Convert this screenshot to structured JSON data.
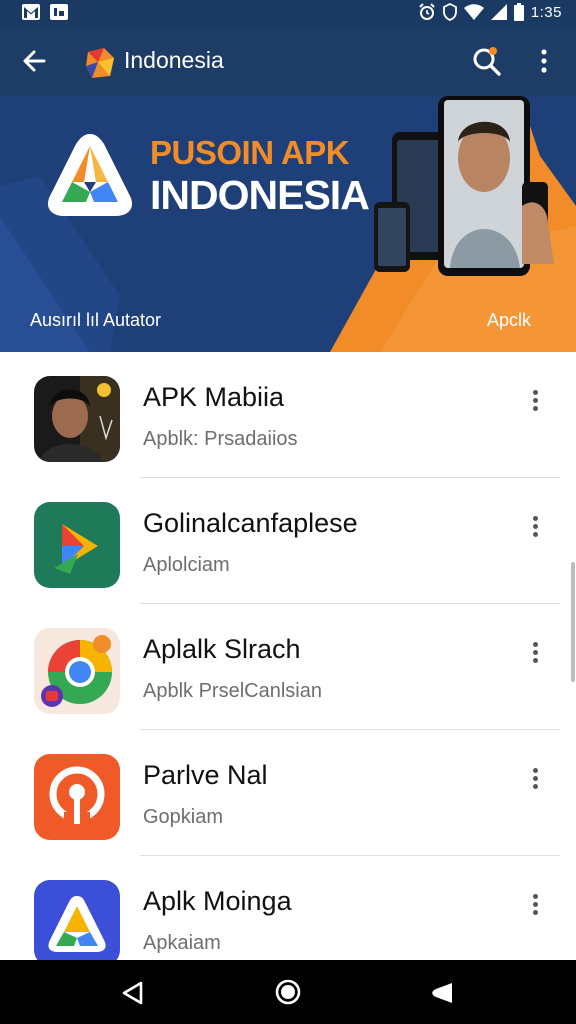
{
  "status_bar": {
    "time": "1:35",
    "icons": [
      "gmail-icon",
      "notification-icon",
      "alarm-icon",
      "vpn-icon",
      "wifi-icon",
      "signal-icon",
      "battery-icon"
    ]
  },
  "app_bar": {
    "title": "Indonesia",
    "icons": [
      "back-arrow-icon",
      "brand-logo-icon",
      "search-icon",
      "more-vert-icon"
    ]
  },
  "banner": {
    "title_line1": "PUSOIN APK",
    "title_line2": "INDONESIA",
    "subtitle_left": "Ausırıl lıl Autator",
    "subtitle_right": "Apclk",
    "colors": {
      "blue": "#1e3f78",
      "orange": "#f28c28"
    }
  },
  "apps": [
    {
      "name": "APK Mabiia",
      "subtitle": "Apblk: Prsadaiios",
      "icon": "portrait-app-icon"
    },
    {
      "name": "Golinalcanfaplese",
      "subtitle": "Aplolciam",
      "icon": "green-play-app-icon"
    },
    {
      "name": "Aplalk Slrach",
      "subtitle": "Apblk PrselCanlsian",
      "icon": "chrome-like-app-icon"
    },
    {
      "name": "Parlve Nal",
      "subtitle": "Gopkiam",
      "icon": "orange-target-app-icon"
    },
    {
      "name": "Aplk Moinga",
      "subtitle": "Apkaiam",
      "icon": "blue-triangle-app-icon"
    }
  ],
  "nav_bar": {
    "icons": [
      "nav-back-icon",
      "nav-home-icon",
      "nav-recent-icon"
    ]
  }
}
